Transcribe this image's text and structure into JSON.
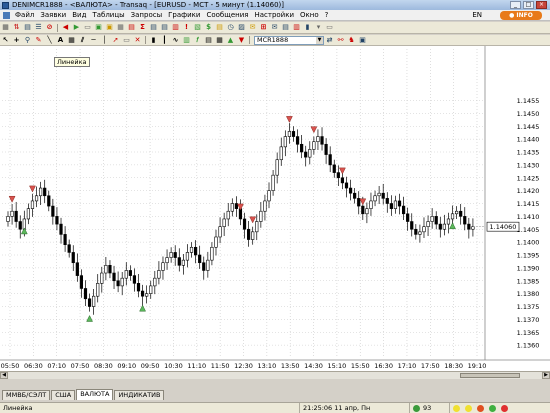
{
  "window": {
    "title": "DENIMCR1888 - <ВАЛЮТА> - Transaq - [EURUSD - MCT - 5 минут (1.14060)]"
  },
  "menu": {
    "items": [
      "Файл",
      "Заявки",
      "Вид",
      "Таблицы",
      "Запросы",
      "Графики",
      "Сообщения",
      "Настройки",
      "Окно",
      "?"
    ],
    "lang": "EN",
    "info_label": "INFO"
  },
  "toolbar": {
    "ticker_value": "MCR1888",
    "tooltip": "Линейка"
  },
  "chart": {
    "current_price_label": "1.14060"
  },
  "chart_data": {
    "type": "candlestick",
    "instrument": "EURUSD",
    "timeframe": "5 минут",
    "current_price": 1.1406,
    "ylim": [
      1.1355,
      1.1475
    ],
    "y_ticks": [
      "1.1455",
      "1.1450",
      "1.1445",
      "1.1440",
      "1.1435",
      "1.1430",
      "1.1425",
      "1.1420",
      "1.1415",
      "1.1410",
      "1.1405",
      "1.1400",
      "1.1395",
      "1.1390",
      "1.1385",
      "1.1380",
      "1.1375",
      "1.1370",
      "1.1365",
      "1.1360"
    ],
    "x_ticks": [
      "05:50",
      "06:30",
      "07:10",
      "07:50",
      "08:30",
      "09:10",
      "09:50",
      "10:30",
      "11:10",
      "11:50",
      "12:30",
      "13:10",
      "13:50",
      "14:30",
      "15:10",
      "15:50",
      "16:30",
      "17:10",
      "17:50",
      "18:30",
      "19:10"
    ],
    "series": [
      {
        "close": [
          1.141,
          1.1412,
          1.1408,
          1.1405,
          1.1409,
          1.1413,
          1.1416,
          1.1418,
          1.1421,
          1.1418,
          1.1414,
          1.141,
          1.1407,
          1.1403,
          1.1399,
          1.1396,
          1.1392,
          1.1387,
          1.1382,
          1.1378,
          1.1375,
          1.1379,
          1.1384,
          1.1388,
          1.1391,
          1.1388,
          1.1385,
          1.1383,
          1.1386,
          1.1389,
          1.1387,
          1.1384,
          1.1381,
          1.1379,
          1.138,
          1.1383,
          1.1386,
          1.1389,
          1.1392,
          1.1394,
          1.1396,
          1.1394,
          1.1391,
          1.1393,
          1.1396,
          1.1398,
          1.1395,
          1.1392,
          1.1389,
          1.1393,
          1.1398,
          1.1402,
          1.1406,
          1.1409,
          1.1412,
          1.1415,
          1.1413,
          1.1409,
          1.1405,
          1.1401,
          1.1404,
          1.1408,
          1.1412,
          1.1416,
          1.142,
          1.1426,
          1.1432,
          1.1437,
          1.1441,
          1.1443,
          1.1441,
          1.1438,
          1.1435,
          1.1433,
          1.1436,
          1.1439,
          1.1441,
          1.1438,
          1.1434,
          1.143,
          1.1427,
          1.1425,
          1.1423,
          1.1421,
          1.1419,
          1.1417,
          1.1414,
          1.1411,
          1.1413,
          1.1416,
          1.1418,
          1.1419,
          1.1417,
          1.1415,
          1.1413,
          1.1416,
          1.1414,
          1.1411,
          1.1408,
          1.1405,
          1.1403,
          1.1404,
          1.1406,
          1.1408,
          1.141,
          1.1407,
          1.1405,
          1.1407,
          1.1409,
          1.1411,
          1.1412,
          1.141,
          1.1407,
          1.1405,
          1.1406
        ]
      }
    ],
    "markers": {
      "buy": [
        4,
        20,
        33,
        109
      ],
      "sell": [
        1,
        6,
        57,
        60,
        69,
        75,
        82,
        87
      ]
    }
  },
  "tabs": [
    "ММВБ/СЭЛТ",
    "США",
    "ВАЛЮТА",
    "ИНДИКАТИВ"
  ],
  "active_tab": "ВАЛЮТА",
  "status": {
    "left": "Линейка",
    "time": "21:25:06  11 апр, Пн",
    "count": "93"
  }
}
